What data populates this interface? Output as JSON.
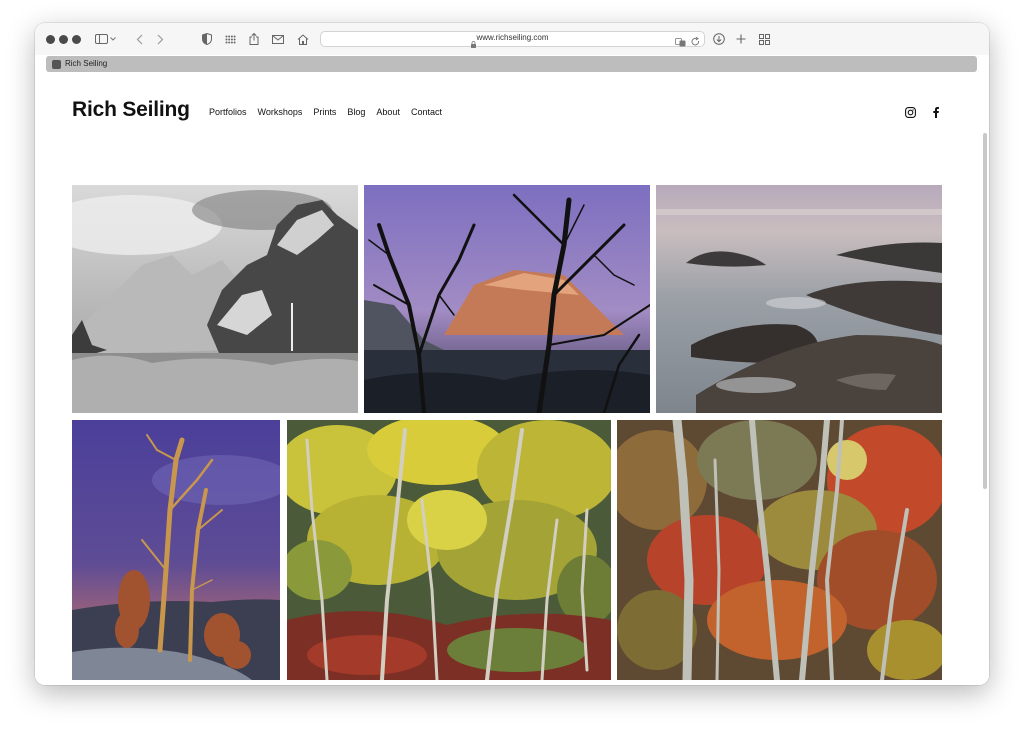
{
  "browser": {
    "url": "www.richseiling.com",
    "tab_title": "Rich Seiling"
  },
  "site": {
    "title": "Rich Seiling",
    "nav": [
      "Portfolios",
      "Workshops",
      "Prints",
      "Blog",
      "About",
      "Contact"
    ]
  },
  "icons": {
    "social": [
      "instagram-icon",
      "facebook-icon"
    ]
  },
  "colors": {
    "toolbar_bg": "#f6f6f6",
    "tab_bar_bg": "#bdbdbd",
    "text": "#111111"
  }
}
